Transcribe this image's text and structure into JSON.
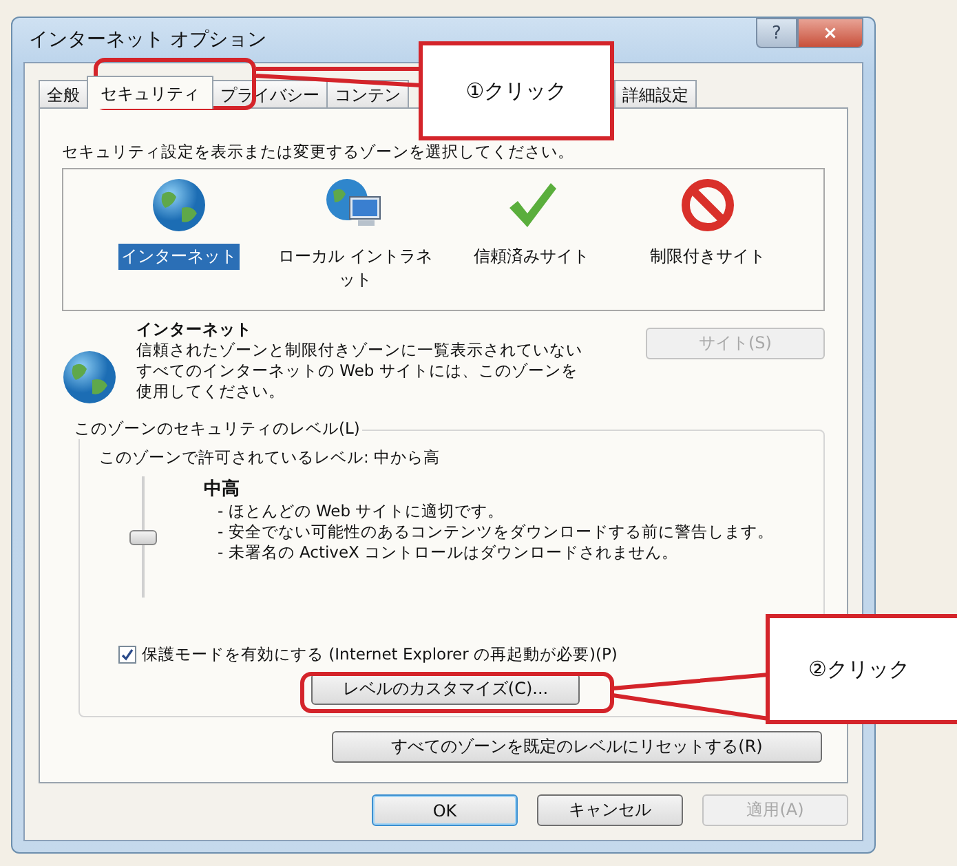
{
  "window": {
    "title": "インターネット オプション",
    "help_button": "?",
    "close_button": "×"
  },
  "tabs": [
    {
      "label": "全般",
      "selected": false
    },
    {
      "label": "セキュリティ",
      "selected": true
    },
    {
      "label": "プライバシー",
      "selected": false
    },
    {
      "label": "コンテン",
      "selected": false
    },
    {
      "label": "詳細設定",
      "selected": false
    }
  ],
  "instruction": "セキュリティ設定を表示または変更するゾーンを選択してください。",
  "zones": [
    {
      "label": "インターネット",
      "kind": "internet",
      "selected": true
    },
    {
      "label": "ローカル イントラネット",
      "kind": "intranet",
      "selected": false
    },
    {
      "label": "信頼済みサイト",
      "kind": "trusted",
      "selected": false
    },
    {
      "label": "制限付きサイト",
      "kind": "restricted",
      "selected": false
    }
  ],
  "zone_info": {
    "title": "インターネット",
    "description": "信頼されたゾーンと制限付きゾーンに一覧表示されていないすべてのインターネットの Web サイトには、このゾーンを使用してください。",
    "sites_button": {
      "label": "サイト(S)",
      "disabled": true
    }
  },
  "security_level": {
    "group_label": "このゾーンのセキュリティのレベル(L)",
    "allowed": "このゾーンで許可されているレベル: 中から高",
    "level": 0.5,
    "level_name": "中高",
    "bullets": [
      "- ほとんどの Web サイトに適切です。",
      "- 安全でない可能性のあるコンテンツをダウンロードする前に警告します。",
      "- 未署名の ActiveX コントロールはダウンロードされません。"
    ]
  },
  "protected_mode": {
    "label": "保護モードを有効にする (Internet Explorer の再起動が必要)(P)",
    "checked": true
  },
  "customize_button": {
    "label": "レベルのカスタマイズ(C)...",
    "disabled": false
  },
  "reset_button": {
    "label": "すべてのゾーンを既定のレベルにリセットする(R)",
    "disabled": false
  },
  "dialog_buttons": [
    {
      "label": "OK",
      "disabled": false
    },
    {
      "label": "キャンセル",
      "disabled": false
    },
    {
      "label": "適用(A)",
      "disabled": true
    }
  ],
  "callouts": [
    {
      "label": "①クリック"
    },
    {
      "label": "②クリック"
    }
  ]
}
